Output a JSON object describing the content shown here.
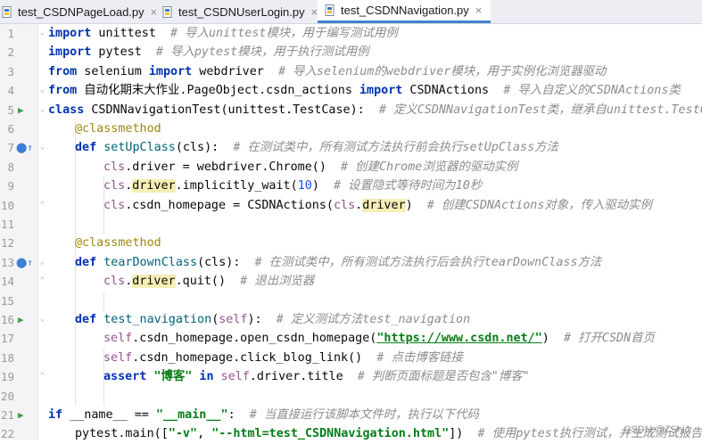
{
  "tabs": [
    {
      "label": "test_CSDNPageLoad.py",
      "close": "×",
      "active": false
    },
    {
      "label": "test_CSDNUserLogin.py",
      "close": "×",
      "active": false
    },
    {
      "label": "test_CSDNNavigation.py",
      "close": "×",
      "active": true
    }
  ],
  "line_numbers": [
    "1",
    "2",
    "3",
    "4",
    "5",
    "6",
    "7",
    "8",
    "9",
    "10",
    "11",
    "12",
    "13",
    "14",
    "15",
    "16",
    "17",
    "18",
    "19",
    "20",
    "21",
    "22"
  ],
  "code": {
    "l1": {
      "kw": "import",
      "name": " unittest",
      "cmt": "  # 导入unittest模块，用于编写测试用例"
    },
    "l2": {
      "kw": "import",
      "name": " pytest",
      "cmt": "  # 导入pytest模块，用于执行测试用例"
    },
    "l3": {
      "kw1": "from",
      "mod": " selenium ",
      "kw2": "import",
      "name": " webdriver",
      "cmt": "  # 导入selenium的webdriver模块，用于实例化浏览器驱动"
    },
    "l4": {
      "kw1": "from",
      "mod": " 自动化期末大作业.PageObject.csdn_actions ",
      "kw2": "import",
      "name": " CSDNActions",
      "cmt": "  # 导入自定义的CSDNActions类"
    },
    "l5": {
      "kw": "class",
      "name": " CSDNNavigationTest(unittest.TestCase):",
      "cmt": "  # 定义CSDNNavigationTest类，继承自unittest.TestCase"
    },
    "l6": {
      "dec": "@classmethod"
    },
    "l7": {
      "kw": "def",
      "fn": " setUpClass",
      "rest": "(cls):",
      "cmt": "  # 在测试类中，所有测试方法执行前会执行setUpClass方法"
    },
    "l8": {
      "self": "cls",
      "rest": ".driver = webdriver.Chrome()",
      "cmt": "  # 创建Chrome浏览器的驱动实例"
    },
    "l9": {
      "self": "cls",
      "dot": ".",
      "hl": "driver",
      "rest": ".implicitly_wait(",
      "num": "10",
      "close": ")",
      "cmt": "  # 设置隐式等待时间为10秒"
    },
    "l10": {
      "self": "cls",
      "rest": ".csdn_homepage = CSDNActions(",
      "self2": "cls",
      "dot": ".",
      "hl": "driver",
      "close": ")",
      "cmt": "  # 创建CSDNActions对象，传入驱动实例"
    },
    "l12": {
      "dec": "@classmethod"
    },
    "l13": {
      "kw": "def",
      "fn": " tearDownClass",
      "rest": "(cls):",
      "cmt": "  # 在测试类中，所有测试方法执行后会执行tearDownClass方法"
    },
    "l14": {
      "self": "cls",
      "dot": ".",
      "hl": "driver",
      "rest": ".quit()",
      "cmt": "  # 退出浏览器"
    },
    "l16": {
      "kw": "def",
      "fn": " test_navigation",
      "open": "(",
      "self": "self",
      "close": "):",
      "cmt": "  # 定义测试方法test_navigation"
    },
    "l17": {
      "self": "self",
      "rest": ".csdn_homepage.open_csdn_homepage(",
      "str": "\"https://www.csdn.net/\"",
      "close": ")",
      "cmt": "  # 打开CSDN首页"
    },
    "l18": {
      "self": "self",
      "rest": ".csdn_homepage.click_blog_link()",
      "cmt": "  # 点击博客链接"
    },
    "l19": {
      "kw": "assert",
      "str": " \"博客\"",
      "kw2": " in",
      "self": " self",
      "rest": ".driver.title",
      "cmt": "  # 判断页面标题是否包含\"博客\""
    },
    "l21": {
      "kw": "if",
      "rest": " __name__ == ",
      "str": "\"__main__\"",
      "colon": ":",
      "cmt": "  # 当直接运行该脚本文件时，执行以下代码"
    },
    "l22": {
      "rest": "pytest.main([",
      "s1": "\"-v\"",
      "comma": ", ",
      "s2": "\"--html=test_CSDNNavigation.html\"",
      "close": "])",
      "cmt": "  # 使用pytest执行测试，并生成测试报告"
    }
  },
  "watermark": "CSDN @ZShiJ",
  "colors": {
    "keyword": "#0033b3",
    "string": "#067d17",
    "comment": "#8c8c8c",
    "self": "#94558d",
    "decorator": "#9e880d",
    "run_icon": "#3aa14a",
    "active_tab_underline": "#4083c9"
  }
}
